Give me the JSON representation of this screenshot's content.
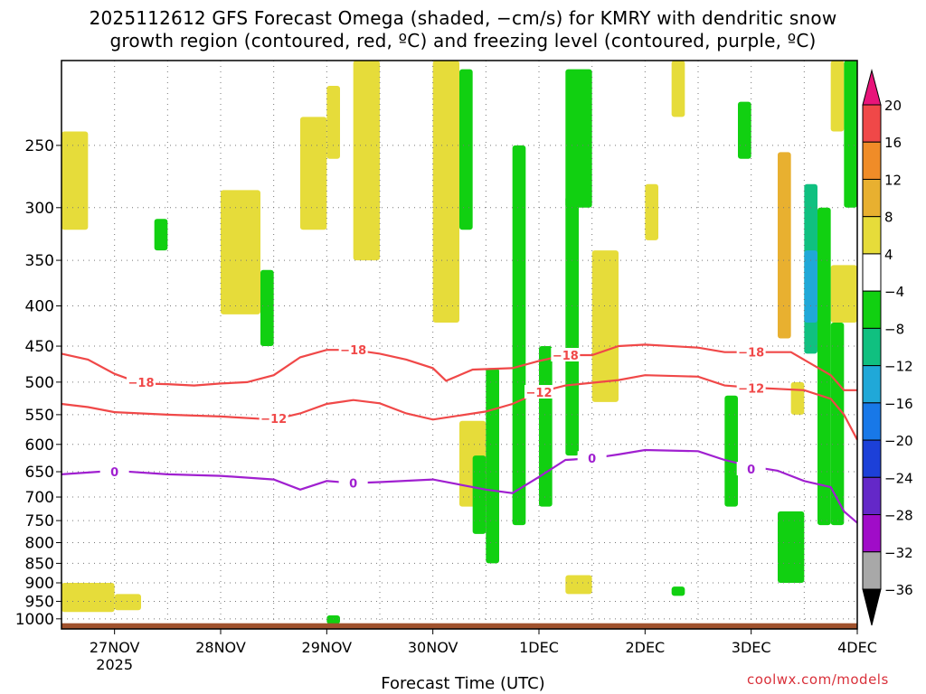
{
  "title_line1": "2025112612 GFS Forecast Omega (shaded, −cm/s) for KMRY with dendritic snow",
  "title_line2": "growth region (contoured, red, ºC) and freezing level (contoured, purple, ºC)",
  "xlabel": "Forecast Time (UTC)",
  "credit": "coolwx.com/models",
  "colors": {
    "temp_contour": "#f04848",
    "freezing_contour": "#a020d0",
    "ground": "#a0522d",
    "grid": "#777777"
  },
  "chart_data": {
    "type": "heatmap",
    "y_axis": {
      "unit": "hPa",
      "scale": "log",
      "reversed": true,
      "range": [
        1030,
        195
      ],
      "ticks": [
        250,
        300,
        350,
        400,
        450,
        500,
        550,
        600,
        650,
        700,
        750,
        800,
        850,
        900,
        950,
        1000
      ]
    },
    "x_axis": {
      "range": [
        "2025-11-26T12",
        "2025-12-04T00"
      ],
      "tick_labels": [
        "27NOV",
        "28NOV",
        "29NOV",
        "30NOV",
        "1DEC",
        "2DEC",
        "3DEC",
        "4DEC"
      ],
      "year_label": "2025",
      "grid": "dotted"
    },
    "colorbar": {
      "labels": [
        "20",
        "16",
        "12",
        "8",
        "4",
        "−4",
        "−8",
        "−12",
        "−16",
        "−20",
        "−24",
        "−28",
        "−32",
        "−36"
      ],
      "colors": [
        "#e8147a",
        "#f04848",
        "#f08c28",
        "#e8b030",
        "#e6dc3a",
        "#ffffff",
        "#11d011",
        "#10c080",
        "#20a8d8",
        "#1878e8",
        "#1c40d8",
        "#6428c8",
        "#a00cc8",
        "#a8a8a8",
        "#000000"
      ]
    },
    "contours": [
      {
        "label": "−18",
        "color": "#f04848",
        "points": [
          [
            "2025-11-26T12",
            460
          ],
          [
            "2025-11-26T18",
            468
          ],
          [
            "2025-11-27T00",
            488
          ],
          [
            "2025-11-27T06",
            502
          ],
          [
            "2025-11-27T12",
            503
          ],
          [
            "2025-11-27T18",
            505
          ],
          [
            "2025-11-28T00",
            502
          ],
          [
            "2025-11-28T06",
            500
          ],
          [
            "2025-11-28T12",
            490
          ],
          [
            "2025-11-28T18",
            465
          ],
          [
            "2025-11-29T00",
            455
          ],
          [
            "2025-11-29T06",
            455
          ],
          [
            "2025-11-29T12",
            460
          ],
          [
            "2025-11-29T18",
            468
          ],
          [
            "2025-11-30T00",
            480
          ],
          [
            "2025-11-30T03",
            498
          ],
          [
            "2025-11-30T09",
            482
          ],
          [
            "2025-11-30T18",
            480
          ],
          [
            "2025-12-01T00",
            470
          ],
          [
            "2025-12-01T06",
            462
          ],
          [
            "2025-12-01T12",
            462
          ],
          [
            "2025-12-01T18",
            450
          ],
          [
            "2025-12-02T00",
            448
          ],
          [
            "2025-12-02T12",
            452
          ],
          [
            "2025-12-02T18",
            458
          ],
          [
            "2025-12-03T00",
            458
          ],
          [
            "2025-12-03T09",
            458
          ],
          [
            "2025-12-03T18",
            490
          ],
          [
            "2025-12-03T21",
            512
          ],
          [
            "2025-12-04T00",
            512
          ]
        ],
        "labels_at": [
          [
            "2025-11-27T06",
            500
          ],
          [
            "2025-11-29T06",
            455
          ],
          [
            "2025-12-01T06",
            462
          ],
          [
            "2025-12-03T00",
            458
          ]
        ]
      },
      {
        "label": "−12",
        "color": "#f04848",
        "points": [
          [
            "2025-11-26T12",
            533
          ],
          [
            "2025-11-26T18",
            538
          ],
          [
            "2025-11-27T00",
            546
          ],
          [
            "2025-11-27T12",
            550
          ],
          [
            "2025-11-28T00",
            553
          ],
          [
            "2025-11-28T12",
            558
          ],
          [
            "2025-11-28T18",
            548
          ],
          [
            "2025-11-29T00",
            533
          ],
          [
            "2025-11-29T06",
            527
          ],
          [
            "2025-11-29T12",
            532
          ],
          [
            "2025-11-29T18",
            548
          ],
          [
            "2025-11-30T00",
            558
          ],
          [
            "2025-11-30T12",
            545
          ],
          [
            "2025-11-30T18",
            533
          ],
          [
            "2025-12-01T00",
            515
          ],
          [
            "2025-12-01T06",
            505
          ],
          [
            "2025-12-01T18",
            497
          ],
          [
            "2025-12-02T00",
            490
          ],
          [
            "2025-12-02T12",
            492
          ],
          [
            "2025-12-02T18",
            505
          ],
          [
            "2025-12-03T00",
            508
          ],
          [
            "2025-12-03T12",
            512
          ],
          [
            "2025-12-03T18",
            525
          ],
          [
            "2025-12-03T21",
            550
          ],
          [
            "2025-12-04T00",
            592
          ]
        ],
        "labels_at": [
          [
            "2025-11-28T12",
            556
          ],
          [
            "2025-12-01T00",
            515
          ],
          [
            "2025-12-03T00",
            509
          ]
        ]
      },
      {
        "label": "0",
        "color": "#a020d0",
        "points": [
          [
            "2025-11-26T12",
            655
          ],
          [
            "2025-11-27T00",
            648
          ],
          [
            "2025-11-27T12",
            655
          ],
          [
            "2025-11-28T00",
            658
          ],
          [
            "2025-11-28T12",
            665
          ],
          [
            "2025-11-28T18",
            685
          ],
          [
            "2025-11-29T00",
            668
          ],
          [
            "2025-11-29T06",
            672
          ],
          [
            "2025-11-29T12",
            670
          ],
          [
            "2025-11-30T00",
            665
          ],
          [
            "2025-11-30T12",
            685
          ],
          [
            "2025-11-30T18",
            692
          ],
          [
            "2025-12-01T00",
            660
          ],
          [
            "2025-12-01T06",
            628
          ],
          [
            "2025-12-01T12",
            625
          ],
          [
            "2025-12-01T18",
            618
          ],
          [
            "2025-12-02T00",
            610
          ],
          [
            "2025-12-02T12",
            612
          ],
          [
            "2025-12-02T18",
            628
          ],
          [
            "2025-12-03T00",
            640
          ],
          [
            "2025-12-03T06",
            648
          ],
          [
            "2025-12-03T12",
            668
          ],
          [
            "2025-12-03T18",
            680
          ],
          [
            "2025-12-03T21",
            730
          ],
          [
            "2025-12-04T00",
            755
          ]
        ],
        "labels_at": [
          [
            "2025-11-27T00",
            650
          ],
          [
            "2025-11-29T06",
            672
          ],
          [
            "2025-12-01T12",
            625
          ],
          [
            "2025-12-03T00",
            645
          ]
        ]
      }
    ],
    "omega_shading": [
      {
        "t": [
          "2025-11-26T12",
          "2025-11-26T18"
        ],
        "p": [
          240,
          320
        ],
        "bin": "4 to 8"
      },
      {
        "t": [
          "2025-11-26T12",
          "2025-11-27T00"
        ],
        "p": [
          900,
          980
        ],
        "bin": "4 to 8"
      },
      {
        "t": [
          "2025-11-27T00",
          "2025-11-27T06"
        ],
        "p": [
          930,
          975
        ],
        "bin": "4 to 8"
      },
      {
        "t": [
          "2025-11-28T00",
          "2025-11-28T09"
        ],
        "p": [
          285,
          410
        ],
        "bin": "4 to 8"
      },
      {
        "t": [
          "2025-11-28T18",
          "2025-11-29T00"
        ],
        "p": [
          230,
          320
        ],
        "bin": "4 to 8"
      },
      {
        "t": [
          "2025-11-29T00",
          "2025-11-29T03"
        ],
        "p": [
          210,
          260
        ],
        "bin": "4 to 8"
      },
      {
        "t": [
          "2025-11-29T06",
          "2025-11-29T12"
        ],
        "p": [
          195,
          350
        ],
        "bin": "4 to 8"
      },
      {
        "t": [
          "2025-11-30T00",
          "2025-11-30T06"
        ],
        "p": [
          195,
          420
        ],
        "bin": "4 to 8"
      },
      {
        "t": [
          "2025-11-30T06",
          "2025-11-30T12"
        ],
        "p": [
          560,
          720
        ],
        "bin": "4 to 8"
      },
      {
        "t": [
          "2025-12-01T12",
          "2025-12-01T18"
        ],
        "p": [
          340,
          530
        ],
        "bin": "4 to 8"
      },
      {
        "t": [
          "2025-12-01T06",
          "2025-12-01T12"
        ],
        "p": [
          880,
          930
        ],
        "bin": "4 to 8"
      },
      {
        "t": [
          "2025-12-02T00",
          "2025-12-02T03"
        ],
        "p": [
          280,
          330
        ],
        "bin": "4 to 8"
      },
      {
        "t": [
          "2025-12-02T06",
          "2025-12-02T09"
        ],
        "p": [
          195,
          230
        ],
        "bin": "4 to 8"
      },
      {
        "t": [
          "2025-12-03T06",
          "2025-12-03T09"
        ],
        "p": [
          255,
          440
        ],
        "bin": "8 to 12"
      },
      {
        "t": [
          "2025-12-03T18",
          "2025-12-03T21"
        ],
        "p": [
          195,
          240
        ],
        "bin": "4 to 8"
      },
      {
        "t": [
          "2025-12-03T18",
          "2025-12-04T00"
        ],
        "p": [
          355,
          420
        ],
        "bin": "4 to 8"
      },
      {
        "t": [
          "2025-12-03T09",
          "2025-12-03T12"
        ],
        "p": [
          500,
          550
        ],
        "bin": "4 to 8"
      },
      {
        "t": [
          "2025-11-27T09",
          "2025-11-27T12"
        ],
        "p": [
          310,
          340
        ],
        "bin": "-4 to -8"
      },
      {
        "t": [
          "2025-11-28T09",
          "2025-11-28T12"
        ],
        "p": [
          360,
          450
        ],
        "bin": "-4 to -8"
      },
      {
        "t": [
          "2025-11-30T06",
          "2025-11-30T09"
        ],
        "p": [
          200,
          320
        ],
        "bin": "-4 to -8"
      },
      {
        "t": [
          "2025-11-30T09",
          "2025-11-30T12"
        ],
        "p": [
          620,
          780
        ],
        "bin": "-4 to -8"
      },
      {
        "t": [
          "2025-11-30T12",
          "2025-11-30T15"
        ],
        "p": [
          480,
          850
        ],
        "bin": "-4 to -8"
      },
      {
        "t": [
          "2025-11-30T18",
          "2025-11-30T21"
        ],
        "p": [
          250,
          760
        ],
        "bin": "-4 to -8"
      },
      {
        "t": [
          "2025-12-01T00",
          "2025-12-01T03"
        ],
        "p": [
          450,
          720
        ],
        "bin": "-4 to -8"
      },
      {
        "t": [
          "2025-12-01T06",
          "2025-12-01T09"
        ],
        "p": [
          290,
          620
        ],
        "bin": "-4 to -8"
      },
      {
        "t": [
          "2025-12-01T06",
          "2025-12-01T12"
        ],
        "p": [
          200,
          300
        ],
        "bin": "-4 to -8"
      },
      {
        "t": [
          "2025-12-02T18",
          "2025-12-02T21"
        ],
        "p": [
          520,
          720
        ],
        "bin": "-4 to -8"
      },
      {
        "t": [
          "2025-12-02T21",
          "2025-12-03T00"
        ],
        "p": [
          220,
          260
        ],
        "bin": "-4 to -8"
      },
      {
        "t": [
          "2025-12-03T06",
          "2025-12-03T12"
        ],
        "p": [
          730,
          900
        ],
        "bin": "-4 to -8"
      },
      {
        "t": [
          "2025-12-03T12",
          "2025-12-03T15"
        ],
        "p": [
          280,
          460
        ],
        "bin": "-8 to -12"
      },
      {
        "t": [
          "2025-12-03T15",
          "2025-12-03T18"
        ],
        "p": [
          300,
          760
        ],
        "bin": "-4 to -8"
      },
      {
        "t": [
          "2025-12-03T18",
          "2025-12-03T21"
        ],
        "p": [
          420,
          760
        ],
        "bin": "-4 to -8"
      },
      {
        "t": [
          "2025-12-03T21",
          "2025-12-04T00"
        ],
        "p": [
          195,
          300
        ],
        "bin": "-4 to -8"
      },
      {
        "t": [
          "2025-12-03T12",
          "2025-12-03T15"
        ],
        "p": [
          340,
          420
        ],
        "bin": "-12 to -16"
      },
      {
        "t": [
          "2025-11-29T00",
          "2025-11-29T03"
        ],
        "p": [
          990,
          1015
        ],
        "bin": "-4 to -8"
      },
      {
        "t": [
          "2025-12-02T06",
          "2025-12-02T09"
        ],
        "p": [
          910,
          935
        ],
        "bin": "-4 to -8"
      }
    ]
  }
}
